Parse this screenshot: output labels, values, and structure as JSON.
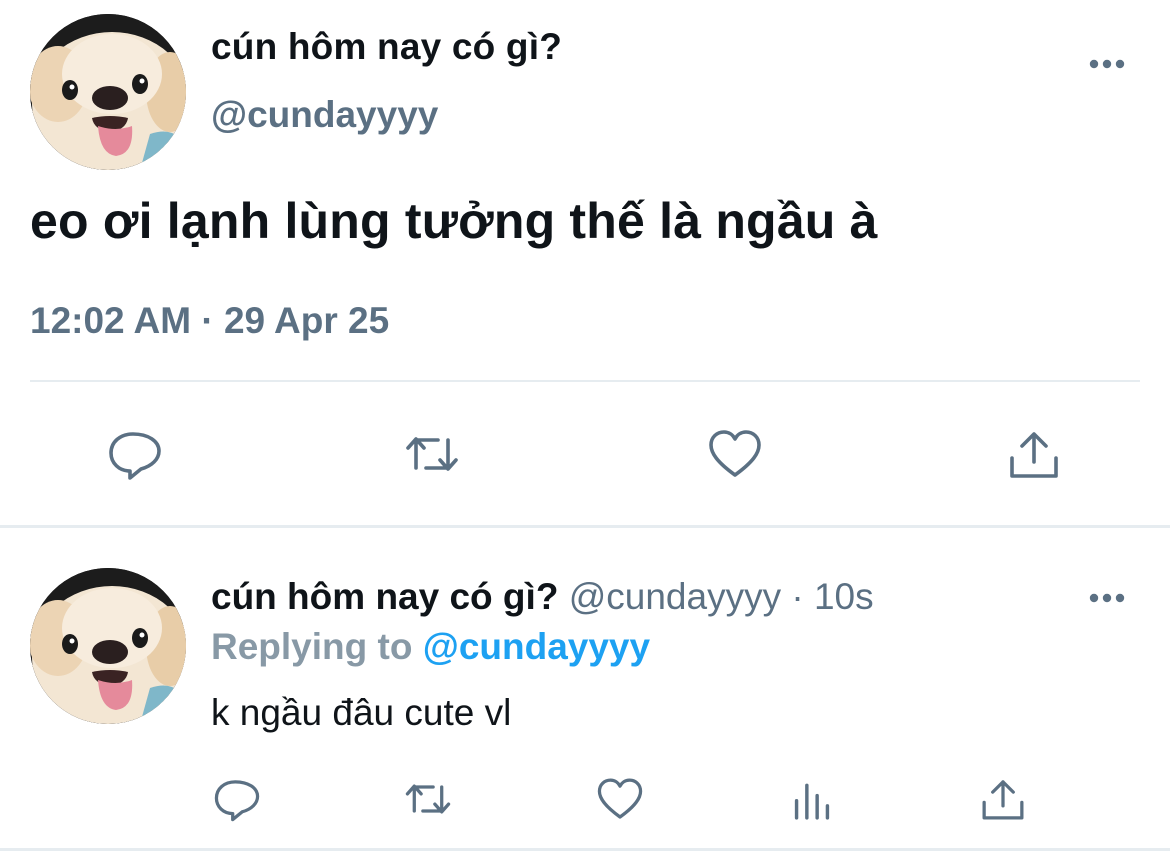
{
  "main_tweet": {
    "author_name": "cún hôm nay có gì?",
    "handle": "@cundayyyy",
    "avatar_icon": "puppy-avatar",
    "text": "eo ơi lạnh lùng tưởng thế là ngầu à",
    "timestamp": "12:02 AM · 29 Apr 25",
    "actions": [
      "reply-icon",
      "retweet-icon",
      "like-icon",
      "share-icon"
    ]
  },
  "reply_tweet": {
    "author_name": "cún hôm nay có gì?",
    "meta": " @cundayyyy · 10s",
    "replying_label": "Replying to ",
    "replying_handle": "@cundayyyy",
    "text": "k ngầu đâu cute vl",
    "avatar_icon": "puppy-avatar",
    "actions": [
      "reply-icon",
      "retweet-icon",
      "like-icon",
      "analytics-icon",
      "share-icon"
    ]
  },
  "colors": {
    "text_primary": "#0f1419",
    "text_secondary": "#5b7083",
    "link_blue": "#1da1f2",
    "divider": "#e6ecf0"
  }
}
